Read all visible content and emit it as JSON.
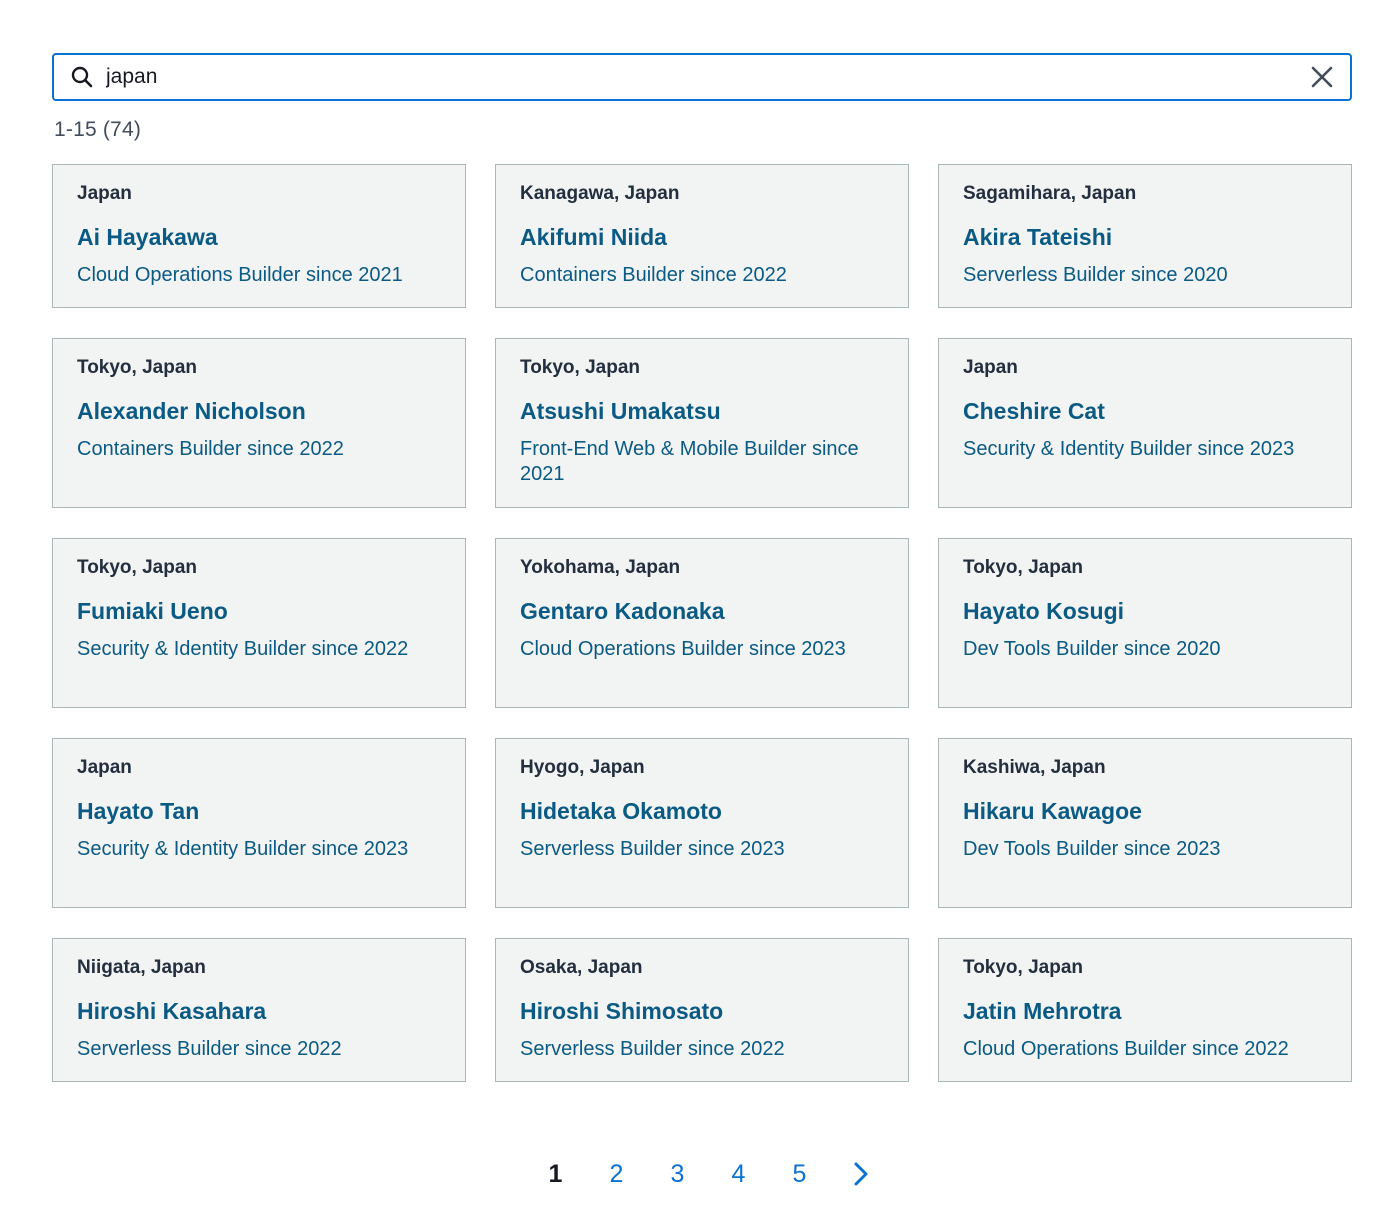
{
  "search": {
    "value": "japan",
    "placeholder": ""
  },
  "result_count": "1-15 (74)",
  "cards": [
    {
      "location": "Japan",
      "name": "Ai Hayakawa",
      "role": "Cloud Operations Builder since 2021"
    },
    {
      "location": "Kanagawa, Japan",
      "name": "Akifumi Niida",
      "role": "Containers Builder since 2022"
    },
    {
      "location": "Sagamihara, Japan",
      "name": "Akira Tateishi",
      "role": "Serverless Builder since 2020"
    },
    {
      "location": "Tokyo, Japan",
      "name": "Alexander Nicholson",
      "role": "Containers Builder since 2022"
    },
    {
      "location": "Tokyo, Japan",
      "name": "Atsushi Umakatsu",
      "role": "Front-End Web & Mobile Builder since 2021"
    },
    {
      "location": "Japan",
      "name": "Cheshire Cat",
      "role": "Security & Identity Builder since 2023"
    },
    {
      "location": "Tokyo, Japan",
      "name": "Fumiaki Ueno",
      "role": "Security & Identity Builder since 2022"
    },
    {
      "location": "Yokohama, Japan",
      "name": "Gentaro Kadonaka",
      "role": "Cloud Operations Builder since 2023"
    },
    {
      "location": "Tokyo, Japan",
      "name": "Hayato Kosugi",
      "role": "Dev Tools Builder since 2020"
    },
    {
      "location": "Japan",
      "name": "Hayato Tan",
      "role": "Security & Identity Builder since 2023"
    },
    {
      "location": "Hyogo, Japan",
      "name": "Hidetaka Okamoto",
      "role": "Serverless Builder since 2023"
    },
    {
      "location": "Kashiwa, Japan",
      "name": "Hikaru Kawagoe",
      "role": "Dev Tools Builder since 2023"
    },
    {
      "location": "Niigata, Japan",
      "name": "Hiroshi Kasahara",
      "role": "Serverless Builder since 2022"
    },
    {
      "location": "Osaka, Japan",
      "name": "Hiroshi Shimosato",
      "role": "Serverless Builder since 2022"
    },
    {
      "location": "Tokyo, Japan",
      "name": "Jatin Mehrotra",
      "role": "Cloud Operations Builder since 2022"
    }
  ],
  "pagination": {
    "pages": [
      "1",
      "2",
      "3",
      "4",
      "5"
    ],
    "current": "1"
  },
  "colors": {
    "accent": "#0972d3",
    "card_text": "#0a5a84",
    "card_bg": "#f2f3f3"
  },
  "icons": {
    "search": "search-icon",
    "clear": "close-icon",
    "next": "chevron-right-icon"
  }
}
